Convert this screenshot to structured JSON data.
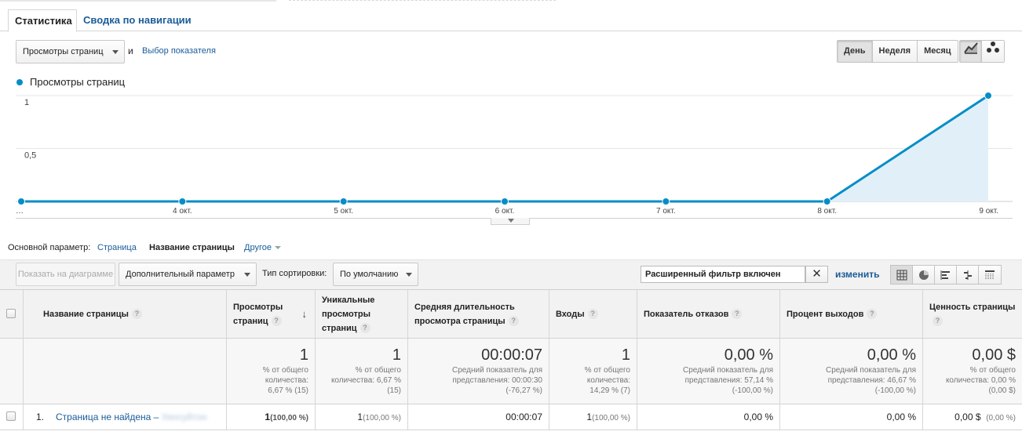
{
  "tabs": [
    {
      "label": "Статистика"
    },
    {
      "label": "Сводка по навигации"
    }
  ],
  "metric": {
    "selected": "Просмотры страниц",
    "and": "и",
    "add_link": "Выбор показателя"
  },
  "period": {
    "options": [
      "День",
      "Неделя",
      "Месяц"
    ],
    "active": "День"
  },
  "chart_view_icons": [
    "line-chart-icon",
    "motion-chart-icon"
  ],
  "legend": {
    "label": "Просмотры страниц",
    "color": "#058dc7"
  },
  "chart_data": {
    "type": "area",
    "series": [
      {
        "name": "Просмотры страниц",
        "values": [
          0,
          0,
          0,
          0,
          0,
          0,
          1
        ]
      }
    ],
    "categories": [
      "…",
      "4 окт.",
      "5 окт.",
      "6 окт.",
      "7 окт.",
      "8 окт.",
      "9 окт."
    ],
    "y_ticks": [
      "0,5",
      "1"
    ],
    "ylim": [
      0,
      1
    ],
    "grid": true,
    "color": "#058dc7",
    "fill": "#e1f0f8"
  },
  "primary_dimension": {
    "label": "Основной параметр:",
    "options": [
      "Страница",
      "Название страницы",
      "Другое"
    ],
    "active": "Название страницы"
  },
  "toolbar": {
    "plot_button": "Показать на диаграмме",
    "secondary_dimension": "Дополнительный параметр",
    "sort_label": "Тип сортировки:",
    "sort_value": "По умолчанию",
    "filter_text": "Расширенный фильтр включен",
    "filter_clear": "✕",
    "filter_edit": "изменить",
    "view_icons": [
      "table-view-icon",
      "pie-view-icon",
      "performance-view-icon",
      "comparison-view-icon",
      "pivot-view-icon"
    ]
  },
  "table": {
    "headers": [
      "Название страницы",
      "Просмотры страниц",
      "Уникальные просмотры страниц",
      "Средняя длительность просмотра страницы",
      "Входы",
      "Показатель отказов",
      "Процент выходов",
      "Ценность страницы"
    ],
    "help": "?",
    "sort_indicator": "↓",
    "totals": [
      {
        "value": "1",
        "sub": [
          "% от общего",
          "количества:",
          "6,67 % (15)"
        ]
      },
      {
        "value": "1",
        "sub": [
          "% от общего",
          "количества: 6,67 %",
          "(15)"
        ]
      },
      {
        "value": "00:00:07",
        "sub": [
          "Средний показатель для",
          "представления: 00:00:30",
          "(-76,27 %)"
        ]
      },
      {
        "value": "1",
        "sub": [
          "% от общего",
          "количества:",
          "14,29 % (7)"
        ]
      },
      {
        "value": "0,00 %",
        "sub": [
          "Средний показатель для",
          "представления: 57,14 %",
          "(-100,00 %)"
        ]
      },
      {
        "value": "0,00 %",
        "sub": [
          "Средний показатель для",
          "представления: 46,67 %",
          "(-100,00 %)"
        ]
      },
      {
        "value": "0,00 $",
        "sub": [
          "% от общего",
          "количества: 0,00 %",
          "(0,00 $)"
        ]
      }
    ],
    "rows": [
      {
        "index": "1.",
        "page_title": "Страница не найдена –",
        "page_title_tail": "Уинсуйтон",
        "pageviews": "1",
        "pageviews_pct": "(100,00 %)",
        "unique": "1",
        "unique_pct": "(100,00 %)",
        "avg_time": "00:00:07",
        "entrances": "1",
        "entrances_pct": "(100,00 %)",
        "bounce": "0,00 %",
        "exit": "0,00 %",
        "value": "0,00 $",
        "value_pct": "(0,00 %)"
      }
    ]
  }
}
